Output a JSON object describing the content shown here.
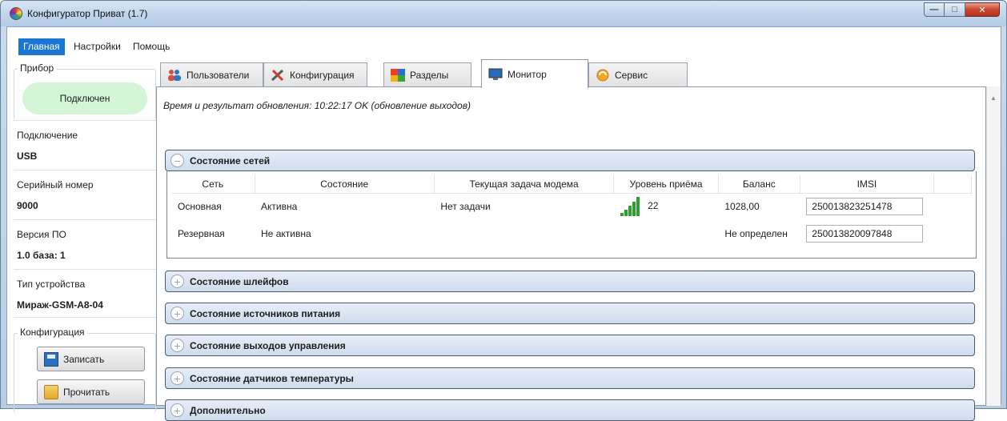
{
  "window": {
    "title": "Конфигуратор Приват (1.7)"
  },
  "menu": {
    "items": [
      "Главная",
      "Настройки",
      "Помощь"
    ]
  },
  "sidebar": {
    "device_group_title": "Прибор",
    "connection_status": "Подключен",
    "fields": [
      {
        "label": "Подключение",
        "value": "USB"
      },
      {
        "label": "Серийный номер",
        "value": "9000"
      },
      {
        "label": "Версия ПО",
        "value": "1.0 база: 1"
      },
      {
        "label": "Тип устройства",
        "value": "Мираж-GSM-A8-04"
      }
    ],
    "config_group_title": "Конфигурация",
    "write_button": "Записать",
    "read_button": "Прочитать"
  },
  "tabs": [
    {
      "label": "Пользователи",
      "icon": "users-icon"
    },
    {
      "label": "Конфигурация",
      "icon": "tools-icon"
    },
    {
      "label": "Разделы",
      "icon": "partitions-icon"
    },
    {
      "label": "Монитор",
      "icon": "monitor-icon"
    },
    {
      "label": "Сервис",
      "icon": "service-icon"
    }
  ],
  "active_tab": "Монитор",
  "update_status": "Время и результат обновления: 10:22:17 OK (обновление выходов)",
  "sections": {
    "networks": "Состояние сетей",
    "loops": "Состояние шлейфов",
    "power": "Состояние источников питания",
    "outputs": "Состояние выходов управления",
    "temperature": "Состояние датчиков температуры",
    "additional": "Дополнительно"
  },
  "networks_table": {
    "headers": [
      "Сеть",
      "Состояние",
      "Текущая задача модема",
      "Уровень приёма",
      "Баланс",
      "IMSI"
    ],
    "rows": [
      {
        "network": "Основная",
        "state": "Активна",
        "task": "Нет задачи",
        "signal": "22",
        "balance": "1028,00",
        "imsi": "250013823251478"
      },
      {
        "network": "Резервная",
        "state": "Не активна",
        "task": "",
        "signal": "",
        "balance": "Не определен",
        "imsi": "250013820097848"
      }
    ]
  },
  "colors": {
    "accent": "#1a76d2",
    "signal_green": "#2e9e33",
    "connected_bg": "#d5f5d7"
  }
}
